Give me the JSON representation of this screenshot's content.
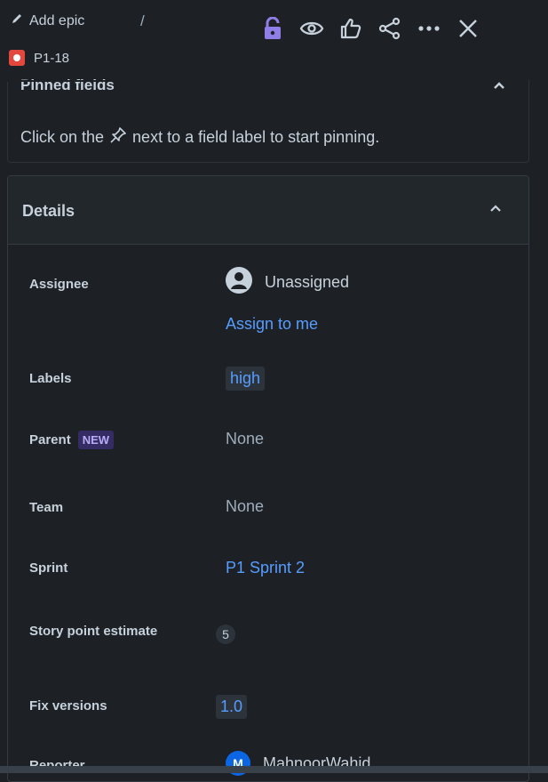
{
  "header": {
    "add_epic": "Add epic",
    "separator": "/",
    "issue_key": "P1-18"
  },
  "actions": [
    "lock-icon",
    "watch-icon",
    "like-icon",
    "share-icon",
    "more-icon",
    "close-icon"
  ],
  "colors": {
    "lock": "#8f7ee7",
    "link": "#579dff",
    "bug": "#e2483d"
  },
  "pinned": {
    "title": "Pinned fields",
    "message_before": "Click on the",
    "message_after": "next to a field label to start pinning."
  },
  "details": {
    "title": "Details",
    "assignee": {
      "label": "Assignee",
      "value": "Unassigned",
      "action": "Assign to me"
    },
    "labels": {
      "label": "Labels",
      "value": "high"
    },
    "parent": {
      "label": "Parent",
      "badge": "NEW",
      "value": "None"
    },
    "team": {
      "label": "Team",
      "value": "None"
    },
    "sprint": {
      "label": "Sprint",
      "value": "P1 Sprint 2"
    },
    "story_points": {
      "label": "Story point estimate",
      "value": "5"
    },
    "fix_versions": {
      "label": "Fix versions",
      "value": "1.0"
    },
    "reporter": {
      "label": "Reporter",
      "avatar": "M",
      "value": "MahnoorWahid"
    }
  }
}
